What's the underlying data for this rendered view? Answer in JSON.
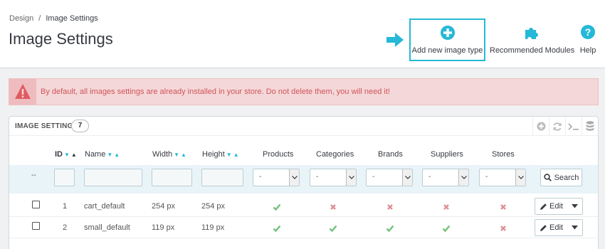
{
  "breadcrumb": {
    "parent": "Design",
    "separator": "/",
    "current": "Image Settings"
  },
  "page_title": "Image Settings",
  "toolbar": {
    "add_label": "Add new image type",
    "recommended_label": "Recommended Modules",
    "help_label": "Help"
  },
  "alert": {
    "text": "By default, all images settings are already installed in your store. Do not delete them, you will need it!"
  },
  "panel": {
    "title": "IMAGE SETTINGS",
    "count": "7",
    "tools": [
      "add-icon",
      "refresh-icon",
      "sql-icon",
      "database-icon"
    ]
  },
  "table": {
    "headers": {
      "id": "ID",
      "name": "Name",
      "width": "Width",
      "height": "Height",
      "products": "Products",
      "categories": "Categories",
      "brands": "Brands",
      "suppliers": "Suppliers",
      "stores": "Stores"
    },
    "filters": {
      "bulk_placeholder": "--",
      "select_value": "-",
      "search_label": "Search"
    },
    "rows": [
      {
        "id": "1",
        "name": "cart_default",
        "width": "254 px",
        "height": "254 px",
        "products": true,
        "categories": false,
        "brands": false,
        "suppliers": false,
        "stores": false,
        "action": "Edit"
      },
      {
        "id": "2",
        "name": "small_default",
        "width": "119 px",
        "height": "119 px",
        "products": true,
        "categories": true,
        "brands": true,
        "suppliers": true,
        "stores": false,
        "action": "Edit"
      }
    ]
  },
  "colors": {
    "accent": "#25b9d7",
    "check": "#72c279",
    "cross": "#e08f95",
    "alert_text": "#d1545a",
    "alert_bg": "#f4d7d8"
  }
}
